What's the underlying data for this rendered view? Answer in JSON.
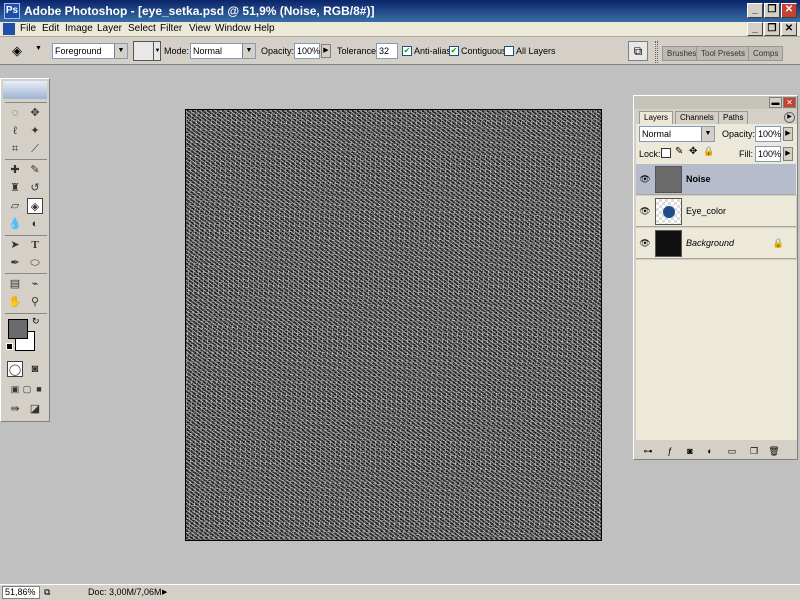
{
  "window": {
    "title": "Adobe Photoshop - [eye_setka.psd @ 51,9% (Noise, RGB/8#)]",
    "app_icon_letter": "Ps",
    "controls": [
      "_",
      "❐",
      "✕"
    ],
    "doc_controls": [
      "_",
      "❐",
      "✕"
    ]
  },
  "menu": [
    "File",
    "Edit",
    "Image",
    "Layer",
    "Select",
    "Filter",
    "View",
    "Window",
    "Help"
  ],
  "options": {
    "fill_source": "Foreground",
    "mode_label": "Mode:",
    "mode_value": "Normal",
    "opacity_label": "Opacity:",
    "opacity_value": "100%",
    "tolerance_label": "Tolerance:",
    "tolerance_value": "32",
    "anti_alias_label": "Anti-alias",
    "contiguous_label": "Contiguous",
    "all_layers_label": "All Layers",
    "anti_alias_checked": true,
    "contiguous_checked": true,
    "all_layers_checked": false,
    "palette_tabs": [
      "Brushes",
      "Tool Presets",
      "Comps"
    ]
  },
  "layers_panel": {
    "tabs": [
      "Layers",
      "Channels",
      "Paths"
    ],
    "active_tab": "Layers",
    "blend_mode": "Normal",
    "opacity_label": "Opacity:",
    "opacity_value": "100%",
    "lock_label": "Lock:",
    "fill_label": "Fill:",
    "fill_value": "100%",
    "layers": [
      {
        "name": "Noise",
        "selected": true,
        "visible": true,
        "locked": false
      },
      {
        "name": "Eye_color",
        "selected": false,
        "visible": true,
        "locked": false
      },
      {
        "name": "Background",
        "selected": false,
        "visible": true,
        "locked": true
      }
    ]
  },
  "status": {
    "zoom": "51,86%",
    "doc_size": "Doc: 3,00M/7,06M"
  },
  "colors": {
    "title_bar": "#0a246a",
    "foreground": "#6b6b6b",
    "background": "#ffffff",
    "panel": "#d4d0c8",
    "workspace": "#c0c0c0"
  }
}
